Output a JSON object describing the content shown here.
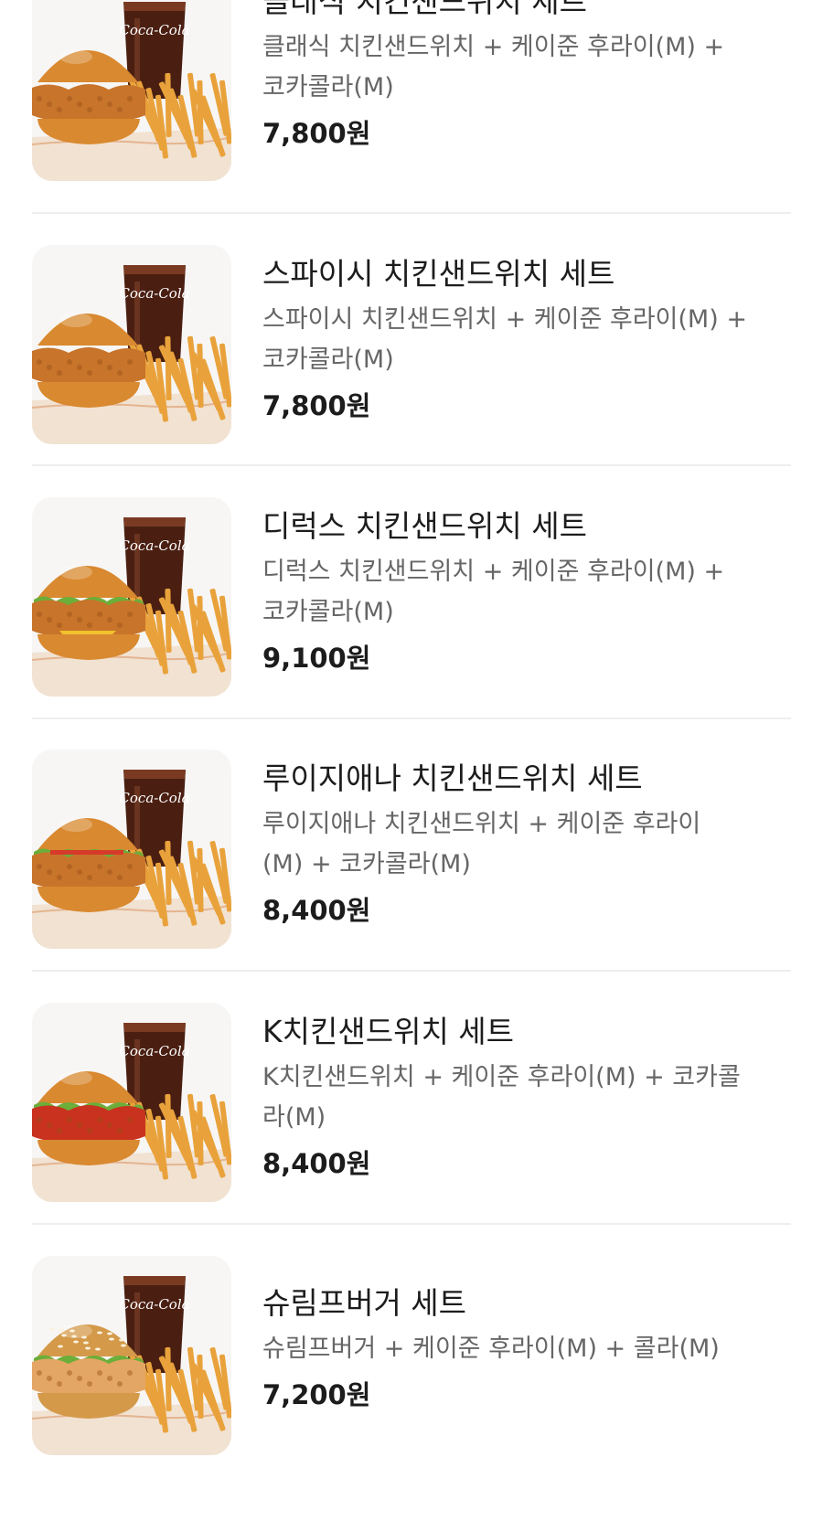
{
  "menu": {
    "items": [
      {
        "name": "클래식 치킨샌드위치 세트",
        "desc_line1": "클래식 치킨샌드위치 + 케이준 후라이(M) +",
        "desc_line2": "코카콜라(M)",
        "price": "7,800원",
        "cup_logo": "Coca-Cola",
        "burger_style": "classic"
      },
      {
        "name": "스파이시 치킨샌드위치 세트",
        "desc_line1": "스파이시 치킨샌드위치 + 케이준 후라이(M) +",
        "desc_line2": "코카콜라(M)",
        "price": "7,800원",
        "cup_logo": "Coca-Cola",
        "burger_style": "spicy"
      },
      {
        "name": "디럭스 치킨샌드위치 세트",
        "desc_line1": "디럭스 치킨샌드위치 + 케이준 후라이(M) +",
        "desc_line2": "코카콜라(M)",
        "price": "9,100원",
        "cup_logo": "Coca-Cola",
        "burger_style": "deluxe"
      },
      {
        "name": "루이지애나 치킨샌드위치 세트",
        "desc_line1": "루이지애나 치킨샌드위치 + 케이준 후라이",
        "desc_line2": "(M) + 코카콜라(M)",
        "price": "8,400원",
        "cup_logo": "Coca-Cola",
        "burger_style": "louisiana"
      },
      {
        "name": "K치킨샌드위치 세트",
        "desc_line1": "K치킨샌드위치 + 케이준 후라이(M) + 코카콜",
        "desc_line2": "라(M)",
        "price": "8,400원",
        "cup_logo": "Coca-Cola",
        "burger_style": "k-chicken"
      },
      {
        "name": "슈림프버거 세트",
        "desc_line1": "슈림프버거 + 케이준 후라이(M) + 콜라(M)",
        "desc_line2": "",
        "price": "7,200원",
        "cup_logo": "Coca-Cola",
        "burger_style": "shrimp"
      }
    ]
  },
  "colors": {
    "background": "#ffffff",
    "title_text": "#1c1c1c",
    "desc_text": "#666666",
    "divider": "#eeeeee",
    "thumb_bg": "#f7f6f5",
    "bun": "#d9892f",
    "fried_chicken": "#c8742a",
    "cola": "#4a1f12",
    "fries": "#e9a23b",
    "lettuce": "#6cae3a",
    "cheese": "#f2c12e",
    "sauce_red": "#c8321e"
  },
  "icons": [
    "burger-set-photo"
  ]
}
